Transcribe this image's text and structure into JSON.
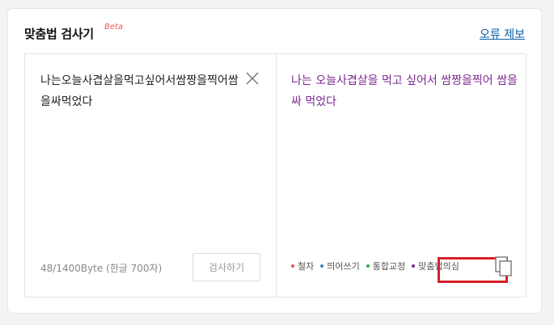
{
  "header": {
    "title": "맞춤법 검사기",
    "beta": "Beta",
    "report_link": "오류 제보"
  },
  "input": {
    "text": "나는오늘사겹살을먹고싶어서쌈짱을찍어쌈을싸먹었다",
    "byte_count": "48/1400Byte (한글 700자)",
    "check_button": "검사하기",
    "clear_icon": "close-icon"
  },
  "result": {
    "text": "나는 오늘사겹살을 먹고 싶어서 쌈짱을찍어 쌈을싸 먹었다",
    "copy_icon": "copy-icon"
  },
  "legend": {
    "items": [
      {
        "label": "철자",
        "color": "#e05a5a"
      },
      {
        "label": "띄어쓰기",
        "color": "#3d86c6"
      },
      {
        "label": "통합교정",
        "color": "#2fa84f"
      },
      {
        "label": "맞춤법의심",
        "color": "#7d2a8f"
      }
    ],
    "highlight_color": "#d81f2b"
  }
}
